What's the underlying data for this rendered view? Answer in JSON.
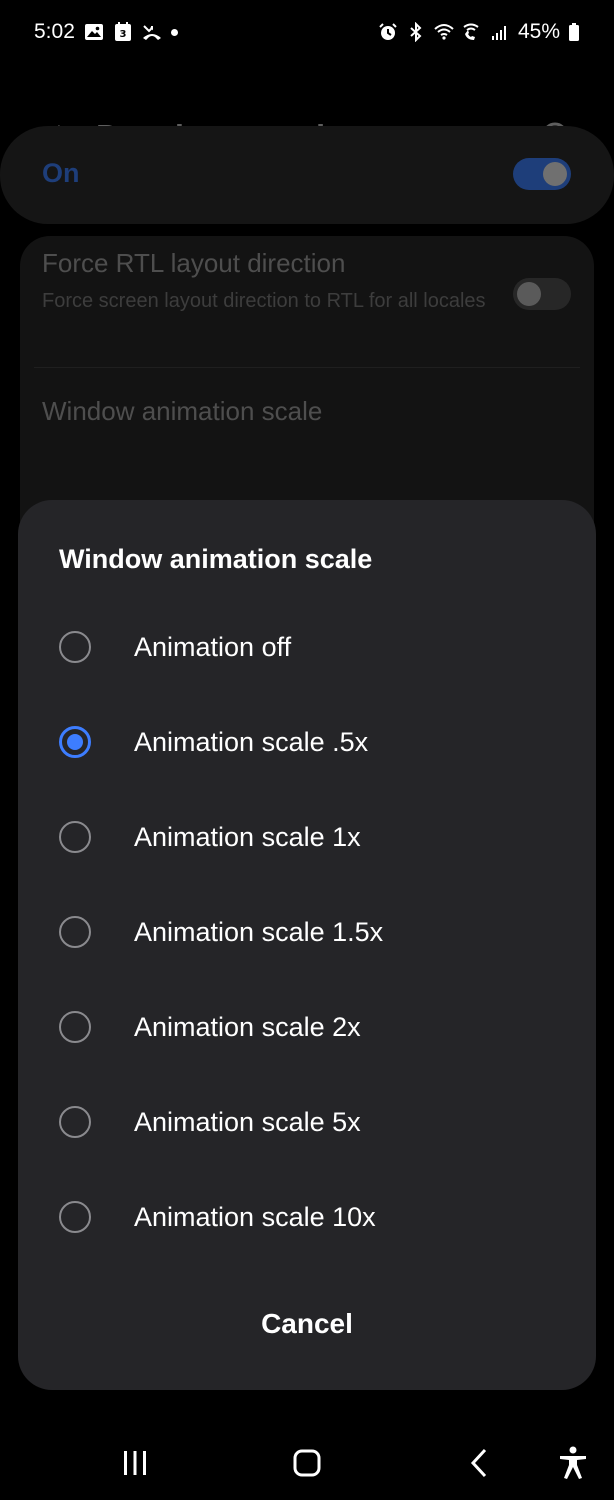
{
  "status_bar": {
    "time": "5:02",
    "left_icons": [
      "gallery-icon",
      "calendar-icon",
      "missed-call-icon"
    ],
    "right_icons": [
      "alarm-icon",
      "bluetooth-icon",
      "wifi-icon",
      "wifi-calling-icon",
      "signal-icon"
    ],
    "battery": "45%",
    "calendar_day": "3"
  },
  "app": {
    "title": "Developer options",
    "master_switch": {
      "label": "On",
      "state": true
    },
    "settings": [
      {
        "title": "Force RTL layout direction",
        "description": "Force screen layout direction to RTL for all locales",
        "state": false
      },
      {
        "title": "Window animation scale"
      }
    ]
  },
  "dialog": {
    "title": "Window animation scale",
    "options": [
      {
        "label": "Animation off",
        "selected": false
      },
      {
        "label": "Animation scale .5x",
        "selected": true
      },
      {
        "label": "Animation scale 1x",
        "selected": false
      },
      {
        "label": "Animation scale 1.5x",
        "selected": false
      },
      {
        "label": "Animation scale 2x",
        "selected": false
      },
      {
        "label": "Animation scale 5x",
        "selected": false
      },
      {
        "label": "Animation scale 10x",
        "selected": false
      }
    ],
    "cancel_label": "Cancel"
  },
  "colors": {
    "accent": "#3d7dff",
    "dialog_bg": "#252528",
    "background": "#000000"
  },
  "nav_bar": {
    "icons": [
      "recents-icon",
      "home-icon",
      "back-icon",
      "accessibility-icon"
    ]
  }
}
